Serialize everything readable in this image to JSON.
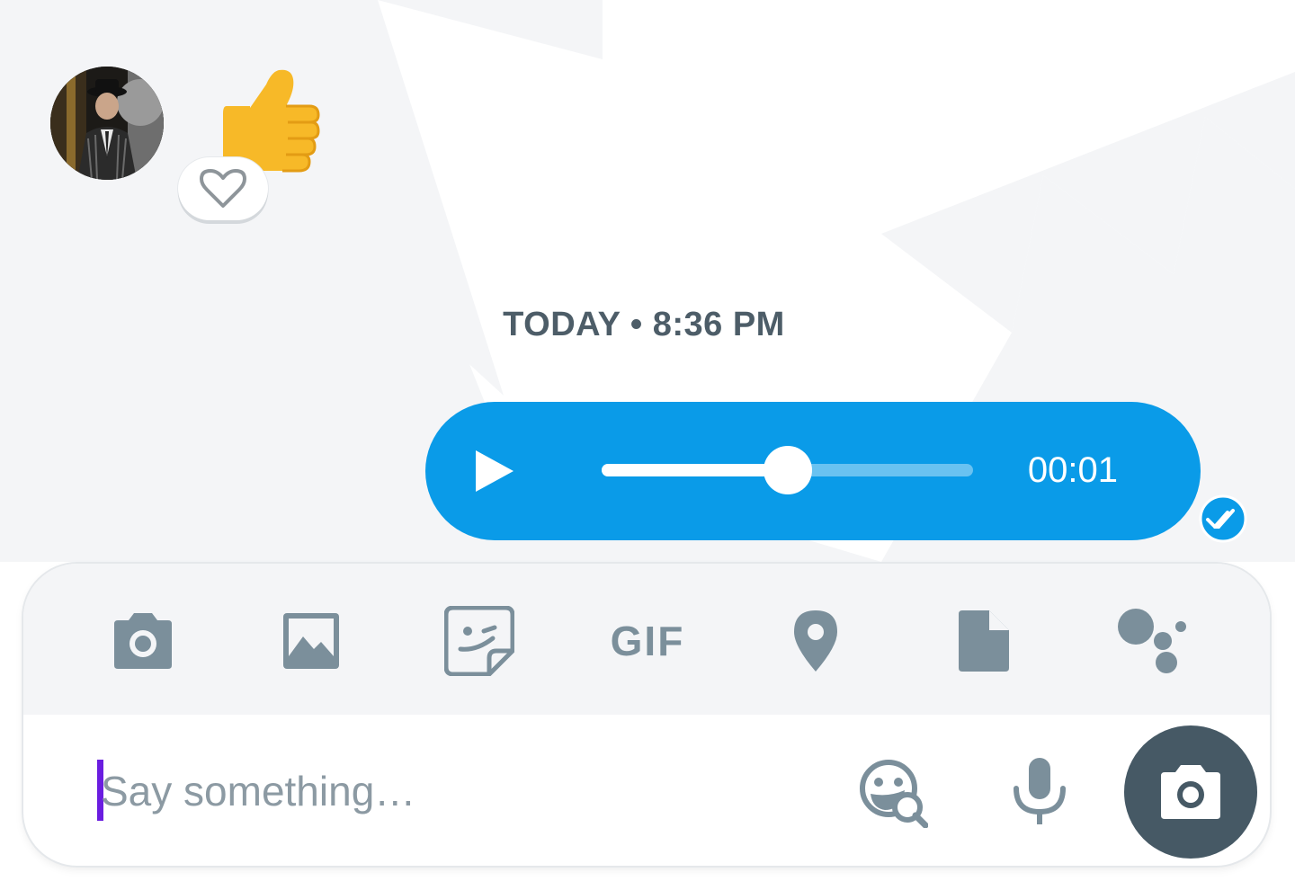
{
  "conversation": {
    "incoming": {
      "avatar_icon": "user-avatar-photo",
      "message_emoji": "thumbs-up-emoji",
      "reaction_button_icon": "heart-outline-icon"
    },
    "timestamp": "TODAY • 8:36 PM",
    "voice_message": {
      "play_icon": "play-icon",
      "progress": 0.5,
      "duration": "00:01",
      "status_icon": "double-check-icon",
      "bubble_color": "#0a9be8"
    }
  },
  "composer": {
    "toolbar": [
      {
        "name": "camera",
        "icon": "camera-icon"
      },
      {
        "name": "gallery",
        "icon": "image-icon"
      },
      {
        "name": "sticker",
        "icon": "sticker-icon"
      },
      {
        "name": "gif",
        "icon": "gif-icon",
        "label": "GIF"
      },
      {
        "name": "location",
        "icon": "location-pin-icon"
      },
      {
        "name": "file",
        "icon": "file-icon"
      },
      {
        "name": "assistant",
        "icon": "assistant-icon"
      }
    ],
    "input_placeholder": "Say something…",
    "emoji_search_icon": "emoji-search-icon",
    "mic_icon": "microphone-icon",
    "camera_button_icon": "camera-icon",
    "icon_color": "#7b8f9b",
    "fab_color": "#465965"
  }
}
